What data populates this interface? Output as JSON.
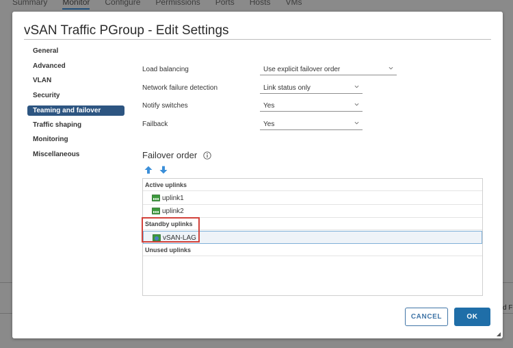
{
  "background": {
    "tabs": [
      "Summary",
      "Monitor",
      "Configure",
      "Permissions",
      "Ports",
      "Hosts",
      "VMs"
    ],
    "active_tab": "Monitor",
    "edge_text": "d F"
  },
  "dialog": {
    "title": "vSAN Traffic PGroup - Edit Settings"
  },
  "nav": {
    "items": [
      "General",
      "Advanced",
      "VLAN",
      "Security",
      "Teaming and failover",
      "Traffic shaping",
      "Monitoring",
      "Miscellaneous"
    ],
    "active_index": 4
  },
  "form": {
    "load_balancing": {
      "label": "Load balancing",
      "value": "Use explicit failover order"
    },
    "network_failure_detection": {
      "label": "Network failure detection",
      "value": "Link status only"
    },
    "notify_switches": {
      "label": "Notify switches",
      "value": "Yes"
    },
    "failback": {
      "label": "Failback",
      "value": "Yes"
    }
  },
  "failover": {
    "title": "Failover order",
    "groups": {
      "active": {
        "label": "Active uplinks",
        "items": [
          "uplink1",
          "uplink2"
        ]
      },
      "standby": {
        "label": "Standby uplinks",
        "items": [
          "vSAN-LAG"
        ]
      },
      "unused": {
        "label": "Unused uplinks",
        "items": []
      }
    }
  },
  "buttons": {
    "cancel": "CANCEL",
    "ok": "OK"
  },
  "colors": {
    "accent": "#2d5581",
    "primary_button": "#1f6ea8",
    "highlight_border": "#d2413a",
    "move_arrow": "#3b8fd9"
  }
}
